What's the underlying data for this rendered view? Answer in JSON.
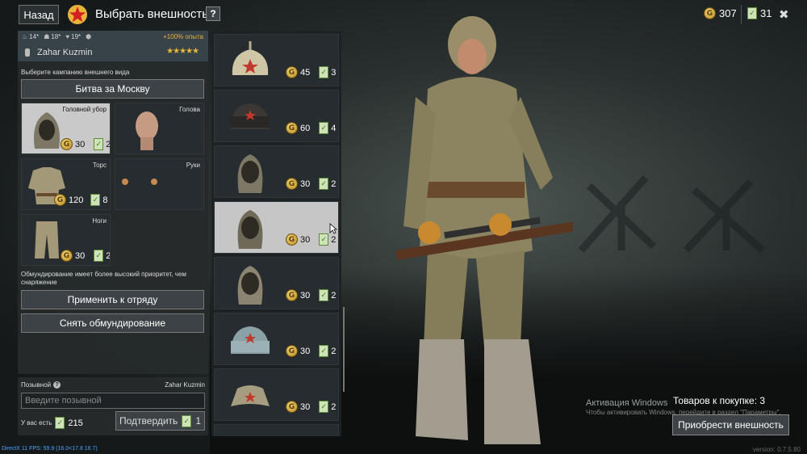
{
  "topbar": {
    "back_label": "Назад",
    "title": "Выбрать внешность",
    "help_label": "?",
    "gold": "307",
    "tickets": "31",
    "close_label": "✖"
  },
  "character": {
    "stats": [
      "14*",
      "18*",
      "19*"
    ],
    "bonus": "+100% опыта",
    "name": "Zahar Kuzmin",
    "rating": "★★★★★"
  },
  "campaign": {
    "label": "Выберите кампанию внешнего вида",
    "selected": "Битва за Москву"
  },
  "slots": [
    {
      "label": "Головной убор",
      "price": "30",
      "tickets": "2",
      "selected": true
    },
    {
      "label": "Голова",
      "price": "",
      "tickets": "",
      "selected": false
    },
    {
      "label": "Торс",
      "price": "120",
      "tickets": "8",
      "selected": false
    },
    {
      "label": "Руки",
      "price": "",
      "tickets": "",
      "selected": false
    },
    {
      "label": "Ноги",
      "price": "30",
      "tickets": "2",
      "selected": false
    }
  ],
  "note": "Обмундирование имеет более высокий приоритет, чем снаряжение",
  "actions": {
    "apply_squad": "Применить к отряду",
    "remove_uniform": "Снять обмундирование"
  },
  "callsign": {
    "label": "Позывной",
    "name": "Zahar Kuzmin",
    "placeholder": "Введите позывной",
    "have_label": "У вас есть",
    "have_tickets": "215",
    "confirm_label": "Подтвердить",
    "confirm_cost": "1"
  },
  "items": [
    {
      "price": "45",
      "tickets": "3",
      "kind": "budenovka-hat-icon"
    },
    {
      "price": "60",
      "tickets": "4",
      "kind": "ushanka-dark-icon"
    },
    {
      "price": "30",
      "tickets": "2",
      "kind": "balaclava-hood-icon"
    },
    {
      "price": "30",
      "tickets": "2",
      "kind": "balaclava-hood-icon",
      "selected": true
    },
    {
      "price": "30",
      "tickets": "2",
      "kind": "balaclava-hood-icon"
    },
    {
      "price": "30",
      "tickets": "2",
      "kind": "ushanka-light-icon"
    },
    {
      "price": "30",
      "tickets": "2",
      "kind": "pilotka-cap-icon"
    }
  ],
  "purchase": {
    "to_buy": "Товаров к покупке: 3",
    "button": "Приобрести внешность"
  },
  "windows": {
    "activation": "Активация Windows",
    "hint": "Чтобы активировать Windows, перейдите в раздел \"Параметры\"."
  },
  "debug": {
    "fps": "DirectX 11 FPS: 59.9 (16.0<17.8 16.7)",
    "version": "version: 0.7.5.80"
  },
  "colors": {
    "accent_gold": "#e9b93a",
    "ticket_green": "#3b7d22",
    "selected_bg": "#c9c9c9"
  }
}
